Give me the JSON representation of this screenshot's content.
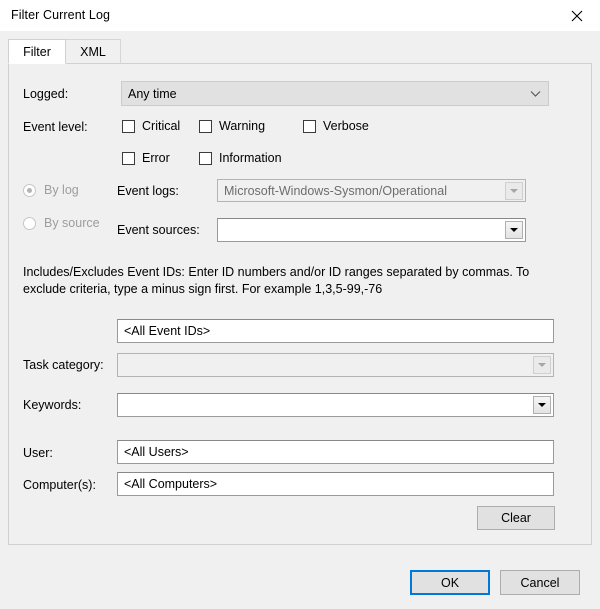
{
  "window": {
    "title": "Filter Current Log",
    "close_icon": "close-icon"
  },
  "tabs": [
    {
      "label": "Filter",
      "selected": true
    },
    {
      "label": "XML",
      "selected": false
    }
  ],
  "form": {
    "logged": {
      "label": "Logged:",
      "value": "Any time",
      "icon": "chevron-down-icon"
    },
    "event_level": {
      "label": "Event level:",
      "checkboxes": [
        {
          "label": "Critical",
          "checked": false
        },
        {
          "label": "Warning",
          "checked": false
        },
        {
          "label": "Verbose",
          "checked": false
        },
        {
          "label": "Error",
          "checked": false
        },
        {
          "label": "Information",
          "checked": false
        }
      ]
    },
    "source_mode": {
      "by_log": {
        "label": "By log",
        "selected": true,
        "disabled": true
      },
      "by_source": {
        "label": "By source",
        "selected": false,
        "disabled": true
      }
    },
    "event_logs": {
      "label": "Event logs:",
      "value": "Microsoft-Windows-Sysmon/Operational",
      "icon": "dropdown-arrow-icon"
    },
    "event_sources": {
      "label": "Event sources:",
      "value": "",
      "icon": "dropdown-arrow-icon"
    },
    "hint": "Includes/Excludes Event IDs: Enter ID numbers and/or ID ranges separated by commas. To exclude criteria, type a minus sign first. For example 1,3,5-99,-76",
    "event_ids": {
      "value": "<All Event IDs>"
    },
    "task_category": {
      "label": "Task category:",
      "value": "",
      "icon": "dropdown-arrow-icon"
    },
    "keywords": {
      "label": "Keywords:",
      "value": "",
      "icon": "dropdown-arrow-icon"
    },
    "user": {
      "label": "User:",
      "value": "<All Users>"
    },
    "computers": {
      "label": "Computer(s):",
      "value": "<All Computers>"
    },
    "clear_button": "Clear"
  },
  "footer": {
    "ok": "OK",
    "cancel": "Cancel"
  },
  "colors": {
    "accent": "#0078d7",
    "dialog_bg": "#f0f0f0",
    "panel_border": "#d0d0d0",
    "disabled_text": "#9d9d9d"
  }
}
